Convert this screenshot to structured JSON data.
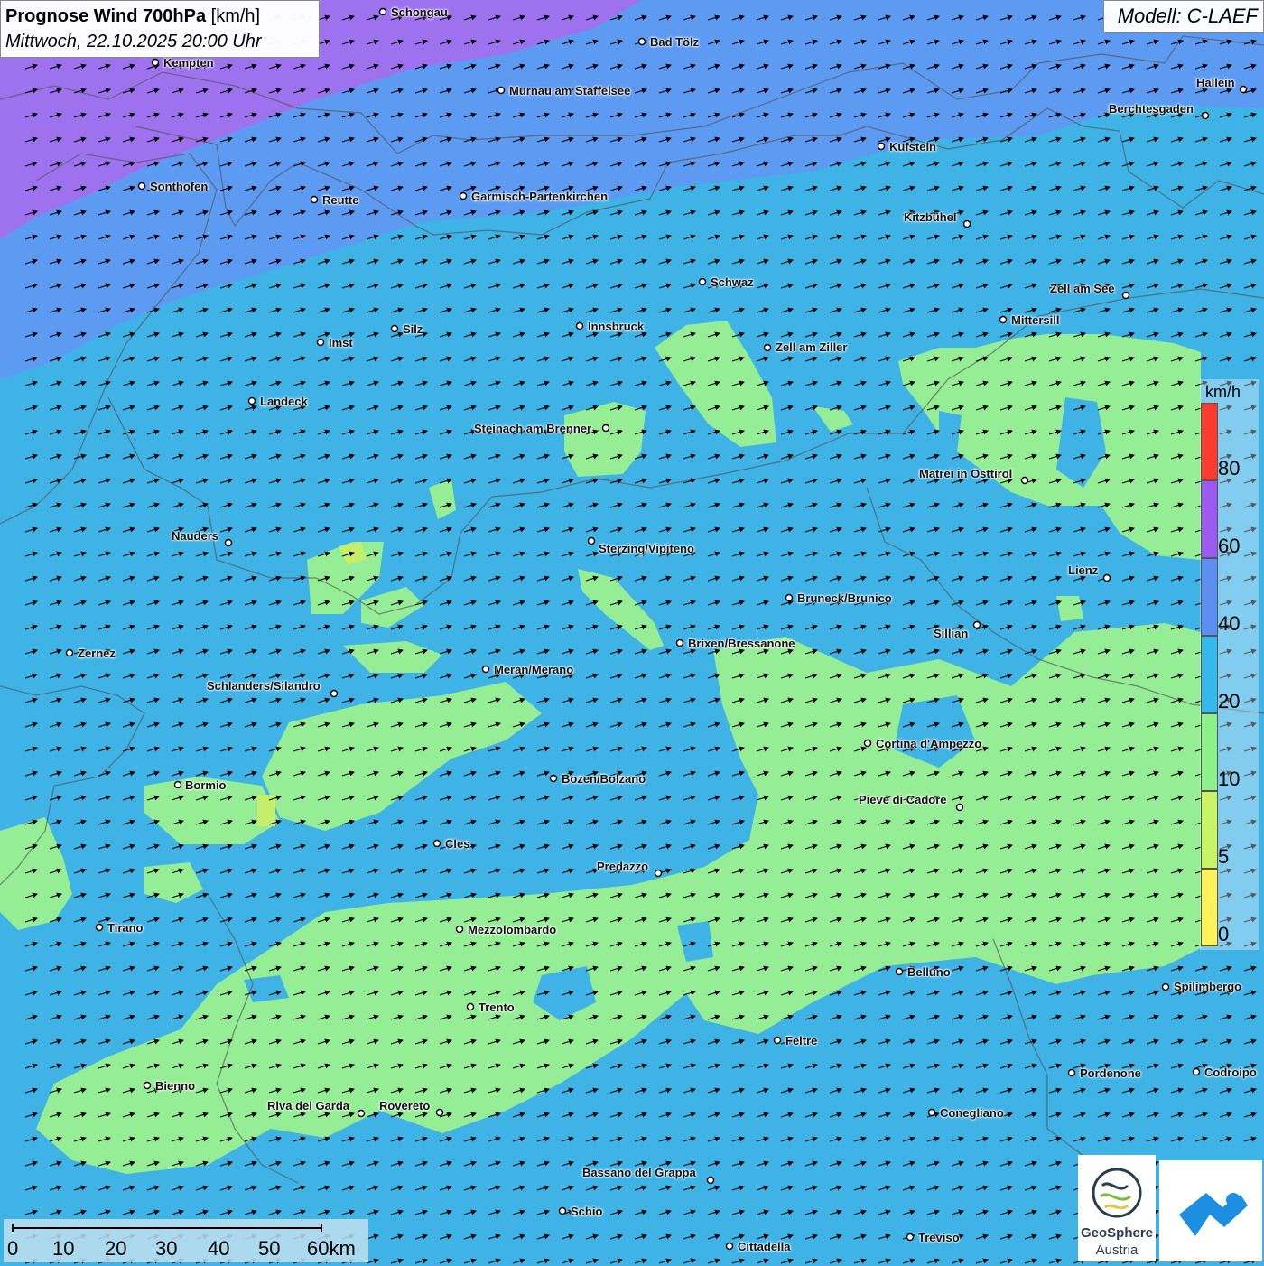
{
  "title": {
    "main": "Prognose Wind 700hPa",
    "unit": "[km/h]",
    "date": "Mittwoch, 22.10.2025 20:00 Uhr"
  },
  "model": "Modell: C-LAEF",
  "legend": {
    "unit": "km/h",
    "bands": [
      {
        "color": "#ff3b30"
      },
      {
        "color": "#9b59f0"
      },
      {
        "color": "#5b8ff0"
      },
      {
        "color": "#35b9ea"
      },
      {
        "color": "#8ef08a"
      },
      {
        "color": "#c8f566"
      },
      {
        "color": "#fff25a"
      }
    ],
    "values": [
      "80",
      "60",
      "40",
      "20",
      "10",
      "5",
      "0"
    ]
  },
  "scale": {
    "ticks": [
      "0",
      "10",
      "20",
      "30",
      "40",
      "50",
      "60km"
    ]
  },
  "logos": {
    "name": "GeoSphere",
    "sub": "Austria"
  },
  "colors": {
    "purple": "#9e72ef",
    "blue": "#5d9af2",
    "cyan": "#3fb3e6",
    "green": "#95ee95",
    "yellowgreen": "#c6ee6a"
  },
  "wind": {
    "direction": "east-northeast",
    "arrow_color": "#000000"
  },
  "cities": [
    {
      "name": "Schongau"
    },
    {
      "name": "Bad Tölz"
    },
    {
      "name": "Kempten"
    },
    {
      "name": "Murnau am Staffelsee"
    },
    {
      "name": "Hallein"
    },
    {
      "name": "Berchtesgaden"
    },
    {
      "name": "Kufstein"
    },
    {
      "name": "Sonthofen"
    },
    {
      "name": "Reutte"
    },
    {
      "name": "Garmisch-Partenkirchen"
    },
    {
      "name": "Kitzbühel"
    },
    {
      "name": "Schwaz"
    },
    {
      "name": "Zell am See"
    },
    {
      "name": "Mittersill"
    },
    {
      "name": "Innsbruck"
    },
    {
      "name": "Imst"
    },
    {
      "name": "Silz"
    },
    {
      "name": "Zell am Ziller"
    },
    {
      "name": "Landeck"
    },
    {
      "name": "Steinach am Brenner"
    },
    {
      "name": "Matrei in Osttirol"
    },
    {
      "name": "Nauders"
    },
    {
      "name": "Sterzing/Vipiteno"
    },
    {
      "name": "Lienz"
    },
    {
      "name": "Bruneck/Brunico"
    },
    {
      "name": "Sillian"
    },
    {
      "name": "Zernez"
    },
    {
      "name": "Brixen/Bressanone"
    },
    {
      "name": "Meran/Merano"
    },
    {
      "name": "Schlanders/Silandro"
    },
    {
      "name": "Cortina d'Ampezzo"
    },
    {
      "name": "Bozen/Bolzano"
    },
    {
      "name": "Bormio"
    },
    {
      "name": "Pieve di Cadore"
    },
    {
      "name": "Cles"
    },
    {
      "name": "Predazzo"
    },
    {
      "name": "Tirano"
    },
    {
      "name": "Mezzolombardo"
    },
    {
      "name": "Belluno"
    },
    {
      "name": "Spilimbergo"
    },
    {
      "name": "Trento"
    },
    {
      "name": "Feltre"
    },
    {
      "name": "Bienno"
    },
    {
      "name": "Pordenone"
    },
    {
      "name": "Codroipo"
    },
    {
      "name": "Riva del Garda"
    },
    {
      "name": "Rovereto"
    },
    {
      "name": "Conegliano"
    },
    {
      "name": "Bassano del Grappa"
    },
    {
      "name": "Schio"
    },
    {
      "name": "Treviso"
    },
    {
      "name": "Cittadella"
    }
  ]
}
